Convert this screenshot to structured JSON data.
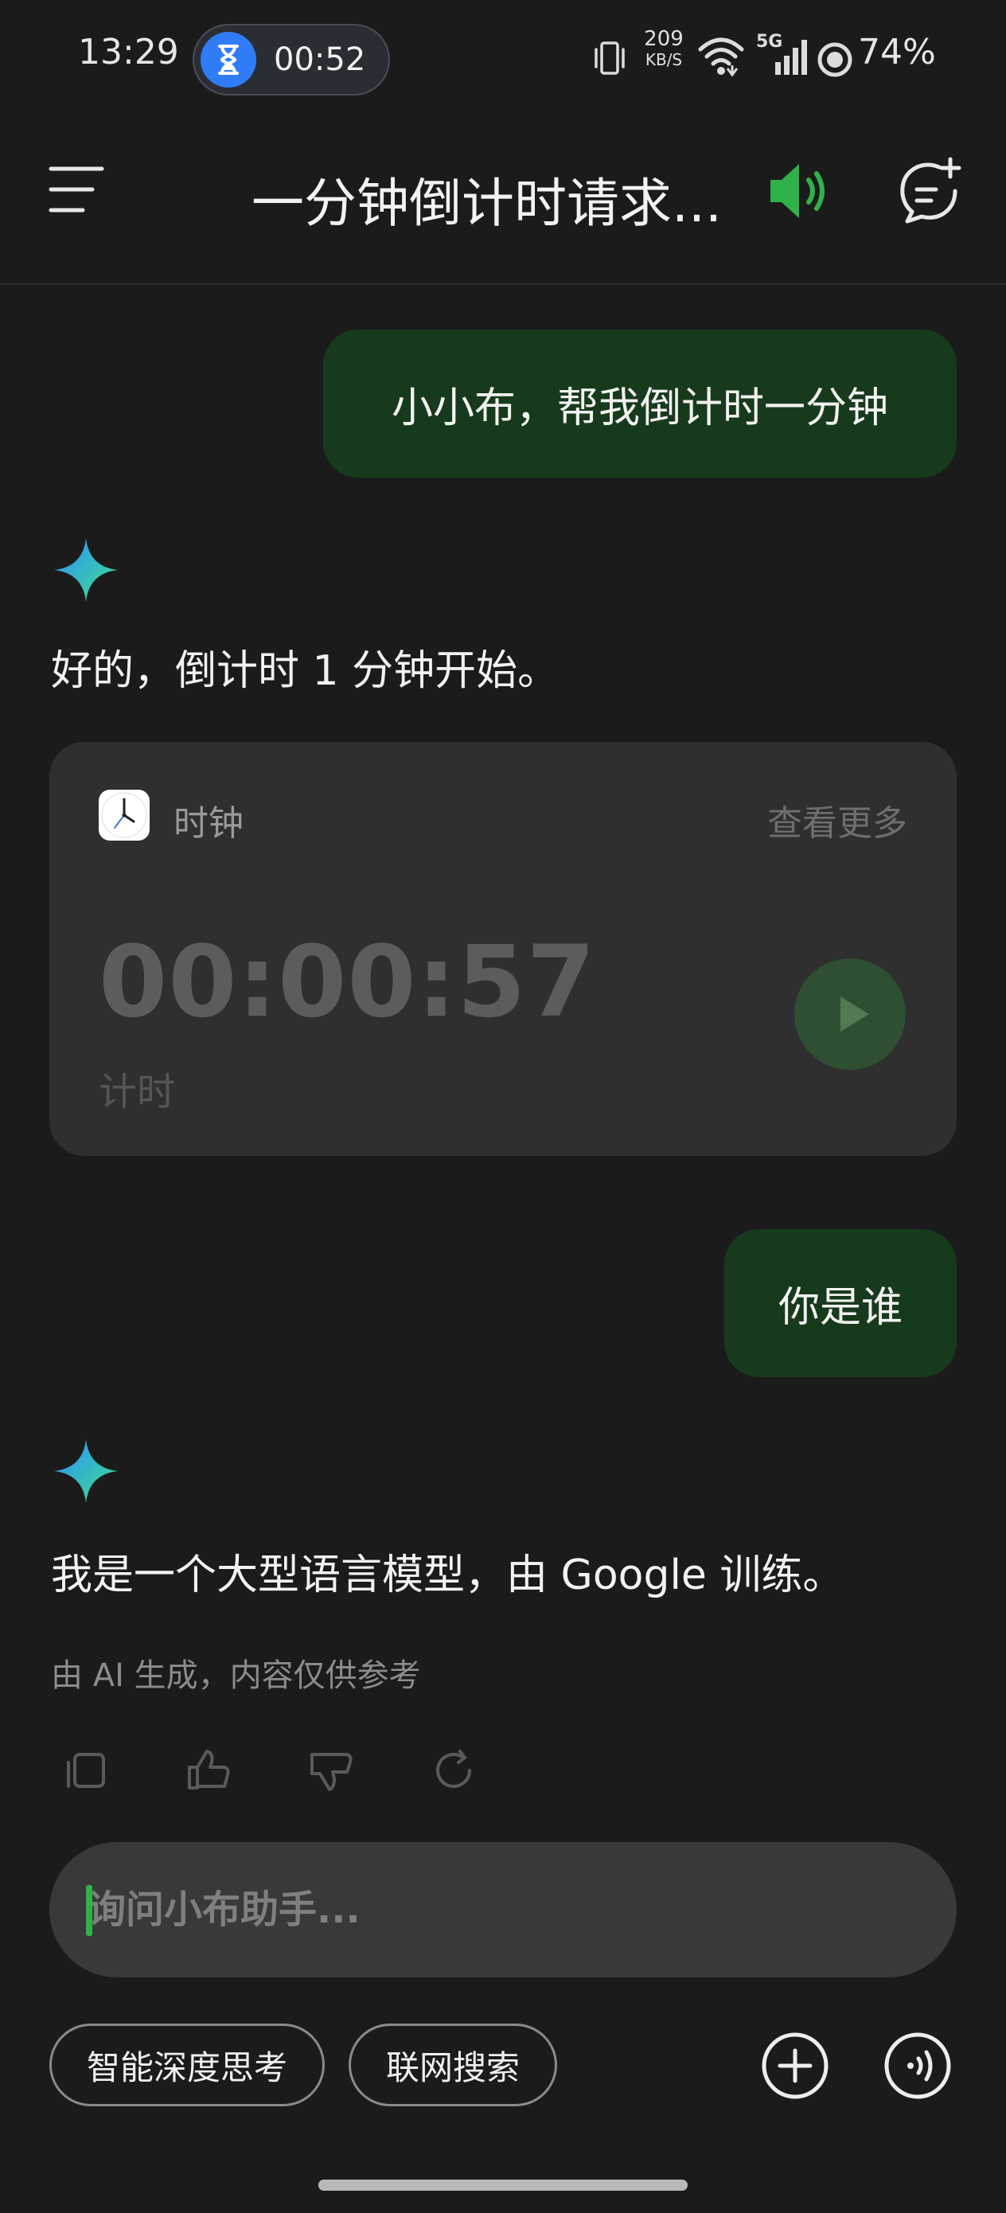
{
  "status_bar": {
    "time": "13:29",
    "timer_pill_time": "00:52",
    "net_speed_value": "209",
    "net_speed_unit": "KB/S",
    "network": "5G",
    "battery": "74%",
    "icons": [
      "hourglass-icon",
      "vibrate-icon",
      "wifi-icon",
      "signal-icon",
      "battery-ring-icon"
    ]
  },
  "header": {
    "title": "一分钟倒计时请求...",
    "icons": [
      "menu-icon",
      "speaker-icon",
      "new-chat-icon"
    ],
    "speaker_color": "#2fb24a"
  },
  "messages": [
    {
      "role": "user",
      "text": "小小布，帮我倒计时一分钟"
    },
    {
      "role": "assistant",
      "text": "好的，倒计时 1 分钟开始。"
    },
    {
      "role": "user",
      "text": "你是谁"
    },
    {
      "role": "assistant",
      "text": "我是一个大型语言模型，由 Google 训练。"
    }
  ],
  "clock_card": {
    "app_name": "时钟",
    "view_more": "查看更多",
    "timer_value": "00:00:57",
    "timer_label": "计时"
  },
  "disclaimer": "由 AI 生成，内容仅供参考",
  "action_icons": [
    "copy-icon",
    "thumbs-up-icon",
    "thumbs-down-icon",
    "regenerate-icon"
  ],
  "input": {
    "placeholder": "询问小布助手...",
    "value": ""
  },
  "chips": [
    "智能深度思考",
    "联网搜索"
  ],
  "bottom_icons": [
    "add-icon",
    "voice-icon"
  ],
  "colors": {
    "accent": "#2fb24a",
    "user_bubble": "#183a1c",
    "background": "#1b1b1b"
  }
}
